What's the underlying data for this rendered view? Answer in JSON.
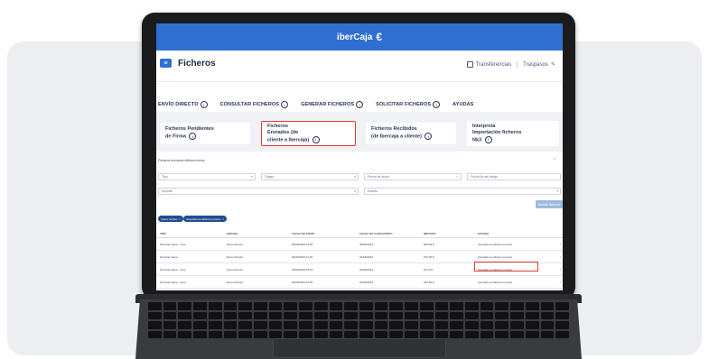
{
  "brand": {
    "name": "iberCaja",
    "icon": "euro-symbol-icon"
  },
  "app": {
    "title": "Ficheros",
    "links": [
      "Transferencias",
      "Traspasos"
    ]
  },
  "tabs": [
    {
      "label": "ENVÍO DIRECTO",
      "info": "i"
    },
    {
      "label": "CONSULTAR FICHEROS",
      "info": ""
    },
    {
      "label": "GENERAR FICHEROS",
      "info": "i"
    },
    {
      "label": "SOLICITAR FICHEROS",
      "info": "i"
    },
    {
      "label": "AYUDAS",
      "info": ""
    }
  ],
  "subtabs": [
    {
      "line1": "Ficheros Pendientes",
      "line2": "de Firma",
      "info": "i"
    },
    {
      "line1": "Ficheros",
      "line2": "Enviados (de",
      "line3": "cliente a Ibercaja)",
      "info": "i"
    },
    {
      "line1": "Ficheros Recibidos",
      "line2": "(de Ibercaja a cliente)",
      "info": "i"
    },
    {
      "line1": "Interpreta",
      "line2": "Importación ficheros",
      "line3": "Nk3",
      "info": "i"
    }
  ],
  "filters": {
    "section_label": "Ficheros enviados últimos meses",
    "collapse_icon": "^",
    "tipo": "Tipo",
    "origen": "Origen",
    "fecha_desde": "Fecha de envío",
    "fecha_hasta": "Fecha fin del rango",
    "importe": "Importe",
    "estado": "Estado",
    "search_button": "Buscar ficheros",
    "chips": [
      {
        "label": "Cierre fechas",
        "icon": "×"
      },
      {
        "label": "Aceptado pendiente proceso",
        "icon": "×"
      }
    ]
  },
  "table": {
    "headers": [
      "TIPO",
      "ORIGEN",
      "FECHA DE ENVÍO",
      "FECHA DE CARGA/PROC.",
      "IMPORTE",
      "ESTADO"
    ],
    "rows": [
      [
        "Nóminas Sepa - Core",
        "Envío Directo",
        "05/06/2023 12:00",
        "05/06/2023",
        "500,00 €",
        "Aceptado pendiente proceso"
      ],
      [
        "Nóminas Sepa",
        "Envío Directo",
        "04/06/2023 11:20",
        "04/06/2023",
        "670,00 €",
        "Aceptado pendiente proceso"
      ],
      [
        "Nóminas Sepa - Core",
        "Envío Directo",
        "04/06/2023 10:10",
        "04/06/2023",
        "52,00 €",
        "Aceptado pendiente proceso"
      ],
      [
        "Nóminas Sepa - Core",
        "Envío Directo",
        "03/06/2023 12:00",
        "03/06/2023",
        "220,00 €",
        "Aceptado pendiente proceso"
      ]
    ]
  },
  "colors": {
    "brand_blue": "#2f6fd2",
    "highlight_red": "#e53935",
    "navy": "#1f4e8f"
  }
}
